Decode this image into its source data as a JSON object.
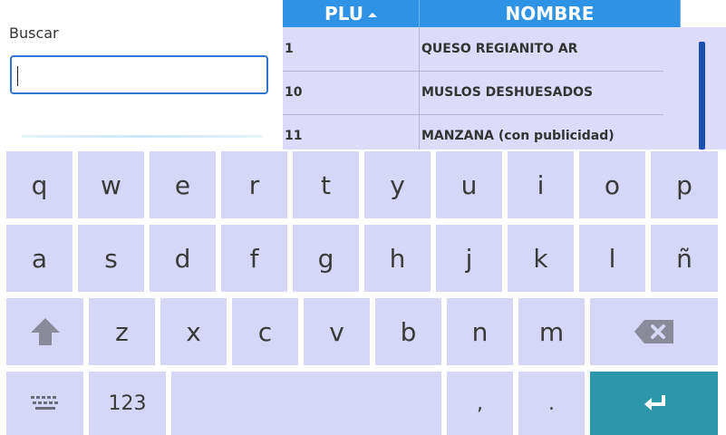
{
  "search": {
    "label": "Buscar",
    "value": ""
  },
  "table": {
    "headers": {
      "plu": "PLU",
      "nombre": "NOMBRE"
    },
    "rows": [
      {
        "plu": "1",
        "nombre": "QUESO REGIANITO AR"
      },
      {
        "plu": "10",
        "nombre": "MUSLOS DESHUESADOS"
      },
      {
        "plu": "11",
        "nombre": "MANZANA (con publicidad)"
      }
    ]
  },
  "keyboard": {
    "row1": [
      "q",
      "w",
      "e",
      "r",
      "t",
      "y",
      "u",
      "i",
      "o",
      "p"
    ],
    "row2": [
      "a",
      "s",
      "d",
      "f",
      "g",
      "h",
      "j",
      "k",
      "l",
      "ñ"
    ],
    "row3": [
      "z",
      "x",
      "c",
      "v",
      "b",
      "n",
      "m"
    ],
    "bottom": {
      "numbers": "123",
      "comma": ",",
      "period": "."
    }
  },
  "colors": {
    "header": "#2e93e6",
    "key": "#d6d6f7",
    "enter": "#2a97aa"
  }
}
